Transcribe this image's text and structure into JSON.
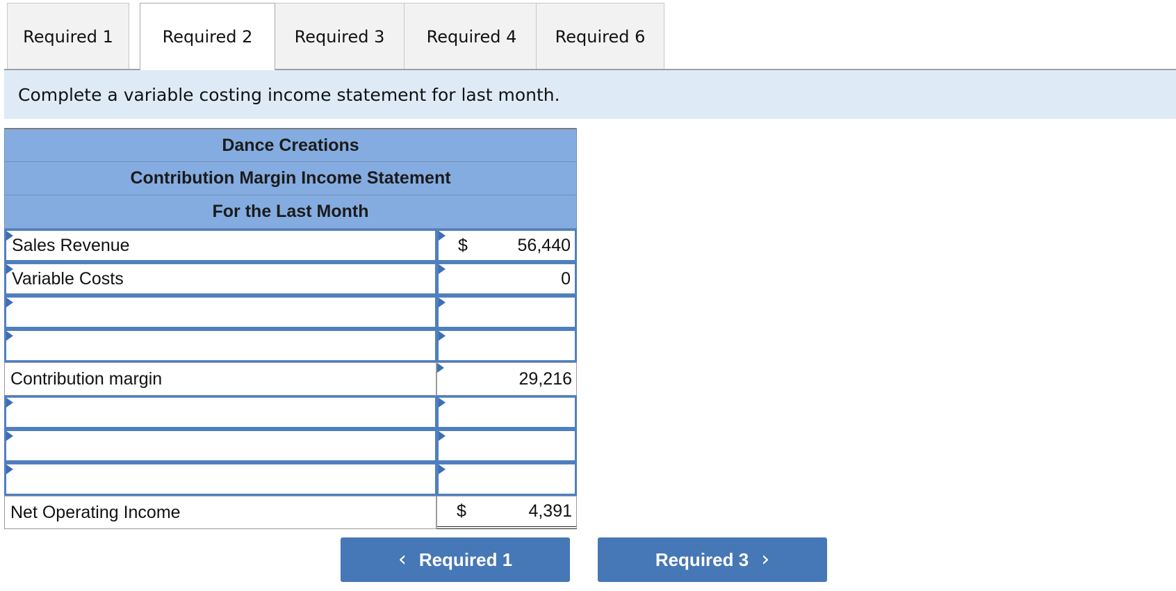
{
  "tabs": [
    {
      "label": "Required 1"
    },
    {
      "label": "Required 2"
    },
    {
      "label": "Required 3"
    },
    {
      "label": "Required 4"
    },
    {
      "label": "Required 6"
    }
  ],
  "instruction": "Complete a variable costing income statement for last month.",
  "statement": {
    "company": "Dance Creations",
    "title": "Contribution Margin Income Statement",
    "period": "For the Last Month",
    "rows": [
      {
        "label": "Sales Revenue",
        "currency": "$",
        "amount": "56,440"
      },
      {
        "label": "Variable Costs",
        "currency": "",
        "amount": "0"
      },
      {
        "label": "",
        "currency": "",
        "amount": ""
      },
      {
        "label": "",
        "currency": "",
        "amount": ""
      },
      {
        "label": "Contribution margin",
        "currency": "",
        "amount": "29,216"
      },
      {
        "label": "",
        "currency": "",
        "amount": ""
      },
      {
        "label": "",
        "currency": "",
        "amount": ""
      },
      {
        "label": "",
        "currency": "",
        "amount": ""
      },
      {
        "label": "Net Operating Income",
        "currency": "$",
        "amount": "4,391"
      }
    ]
  },
  "nav": {
    "prev_label": "Required 1",
    "next_label": "Required 3",
    "prev_icon": "chevron-left-icon",
    "next_icon": "chevron-right-icon"
  },
  "colors": {
    "header_bg": "#84ace0",
    "instruction_bg": "#deebf7",
    "button_bg": "#4677b6",
    "input_border": "#4f7fbf"
  }
}
